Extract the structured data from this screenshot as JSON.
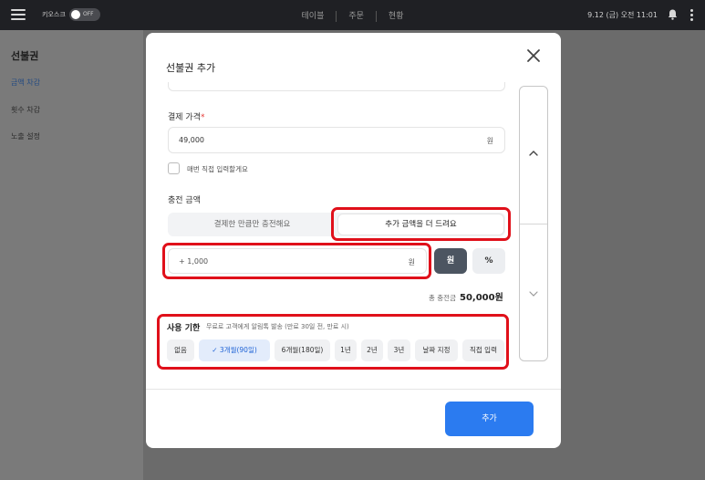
{
  "topbar": {
    "kiosk_label": "키오스크",
    "kiosk_toggle": "OFF",
    "nav": [
      "테이블",
      "주문",
      "현황"
    ],
    "status_time": "9.12 (금) 오전 11:01"
  },
  "sidebar": {
    "title": "선불권",
    "items": [
      {
        "label": "금액 차감"
      },
      {
        "label": "횟수 차감"
      },
      {
        "label": "노출 설정"
      }
    ]
  },
  "modal": {
    "title": "선불권 추가",
    "payment_price": {
      "label": "결제 가격",
      "required_mark": "*",
      "value": "49,000",
      "unit": "원"
    },
    "manual_input_checkbox": {
      "label": "매번 직접 입력할게요",
      "checked": false
    },
    "charge_amount": {
      "label": "충전 금액",
      "options": [
        "결제한 만큼만 충전해요",
        "추가 금액을 더 드려요"
      ],
      "selected_option": "추가 금액을 더 드려요",
      "bonus_value": "+  1,000",
      "bonus_unit": "원",
      "unit_buttons": [
        "원",
        "%"
      ],
      "selected_unit": "원",
      "total_label": "총 충전금",
      "total_value": "50,000원"
    },
    "usage_period": {
      "label": "사용 기한",
      "note": "무료로 고객에게 알림톡 발송 (만료 30일 전, 만료 시)",
      "options": [
        "없음",
        "3개월(90일)",
        "6개월(180일)",
        "1년",
        "2년",
        "3년",
        "날짜 지정",
        "직접 입력"
      ],
      "selected": "3개월(90일)",
      "check_mark": "✓"
    },
    "add_button": "추가"
  },
  "colors": {
    "primary": "#2b7bf0",
    "highlight_box": "#e0101a",
    "selected_chip_text": "#1f63d6",
    "unit_selected_bg": "#4c5561"
  },
  "icons": [
    "hamburger-icon",
    "bell-icon",
    "more-vertical-icon",
    "close-icon",
    "check-icon",
    "chevron-up-icon",
    "chevron-down-icon"
  ]
}
